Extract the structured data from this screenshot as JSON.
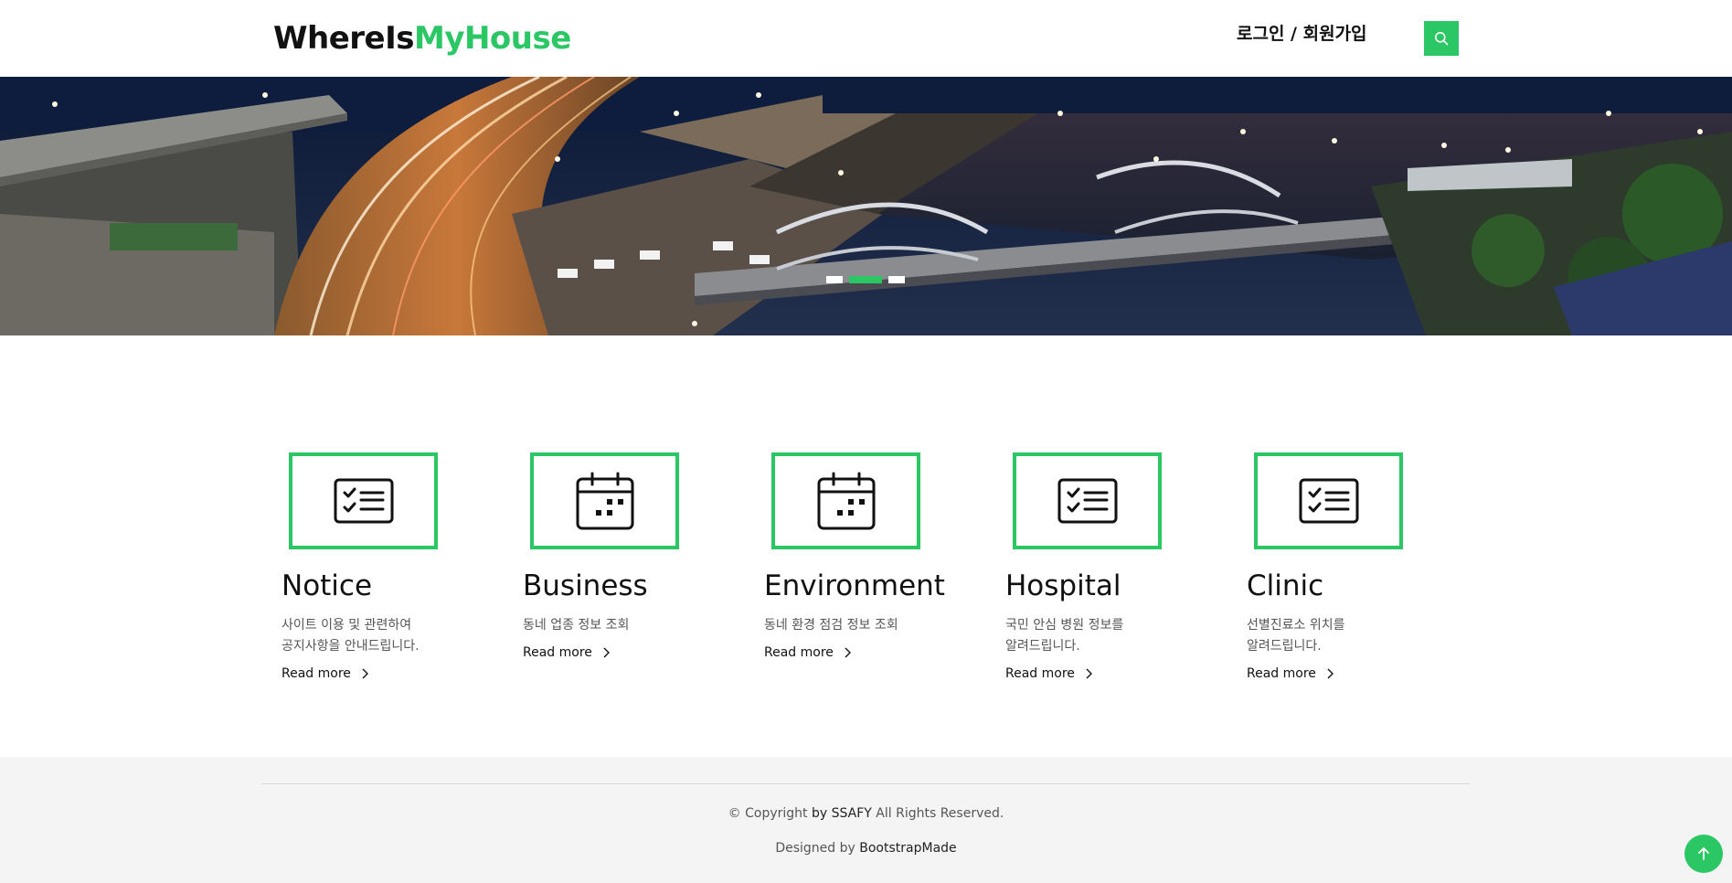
{
  "header": {
    "logo_part1": "WhereIs",
    "logo_part2": "MyHouse",
    "login_label": "로그인 / 회원가입",
    "search_icon": "search-icon"
  },
  "hero": {
    "slides_count": 3,
    "active_slide": 2
  },
  "services": [
    {
      "icon": "checklist-icon",
      "title": "Notice",
      "desc_line1": "사이트 이용 및 관련하여",
      "desc_line2": "공지사항을 안내드립니다.",
      "link": "Read more"
    },
    {
      "icon": "calendar-icon",
      "title": "Business",
      "desc_line1": "동네 업종 정보 조회",
      "desc_line2": "",
      "link": "Read more"
    },
    {
      "icon": "calendar-icon",
      "title": "Environment",
      "desc_line1": "동네 환경 점검 정보 조회",
      "desc_line2": "",
      "link": "Read more"
    },
    {
      "icon": "checklist-icon",
      "title": "Hospital",
      "desc_line1": "국민 안심 병원 정보를",
      "desc_line2": "알려드립니다.",
      "link": "Read more"
    },
    {
      "icon": "checklist-icon",
      "title": "Clinic",
      "desc_line1": "선별진료소 위치를",
      "desc_line2": "알려드립니다.",
      "link": "Read more"
    }
  ],
  "footer": {
    "copyright_prefix": "© Copyright ",
    "copyright_by": "by SSAFY",
    "copyright_suffix": " All Rights Reserved.",
    "designed_prefix": "Designed by ",
    "designed_by": "BootstrapMade"
  },
  "colors": {
    "accent": "#2bc764"
  }
}
